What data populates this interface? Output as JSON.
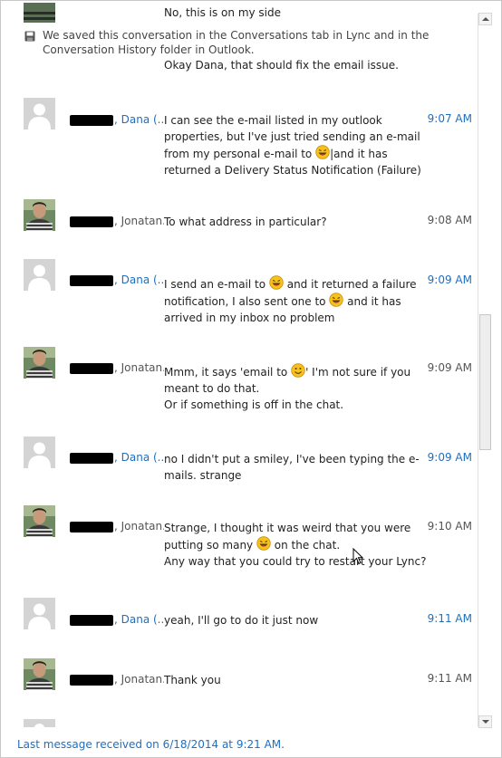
{
  "top_partial_text": "No, this is on my side",
  "saved_notice": "We saved this conversation in the Conversations tab in Lync and in the Conversation History folder in Outlook.",
  "saved_followup": "Okay Dana, that should fix the email issue.",
  "messages": [
    {
      "sender": "Dana (...",
      "is_me": true,
      "time": "9:07 AM",
      "parts": [
        "I can see the e-mail listed in my outlook properties, but I've just tried sending an e-mail from my personal e-mail to ",
        "[emoticon]",
        "|and it has returned a Delivery Status Notification (Failure)"
      ]
    },
    {
      "sender": "Jonatan...",
      "is_me": false,
      "time": "9:08 AM",
      "parts": [
        "To what address in particular?"
      ]
    },
    {
      "sender": "Dana (...",
      "is_me": true,
      "time": "9:09 AM",
      "parts": [
        "I send an e-mail to ",
        "[emoticon]",
        " and it returned a failure notification, I also sent one to ",
        "[emoticon]",
        " and it has arrived in my inbox no problem"
      ]
    },
    {
      "sender": "Jonatan...",
      "is_me": false,
      "time": "9:09 AM",
      "parts": [
        "Mmm, it says 'email to ",
        "[smile]",
        "' I'm not sure if you meant to do that.\nOr if something is off in the chat."
      ]
    },
    {
      "sender": "Dana (...",
      "is_me": true,
      "time": "9:09 AM",
      "parts": [
        "no I didn't put a smiley, I've been typing the e-mails. strange"
      ]
    },
    {
      "sender": "Jonatan...",
      "is_me": false,
      "time": "9:10 AM",
      "parts": [
        "Strange, I thought it was weird that you were putting so many ",
        "[emoticon]",
        " on the chat.\nAny way that you could try to restart your Lync?"
      ]
    },
    {
      "sender": "Dana (...",
      "is_me": true,
      "time": "9:11 AM",
      "parts": [
        "yeah, I'll go to do it just now"
      ]
    },
    {
      "sender": "Jonatan...",
      "is_me": false,
      "time": "9:11 AM",
      "parts": [
        "Thank you"
      ]
    }
  ],
  "status_bar": "Last message received on 6/18/2014 at 9:21 AM.",
  "colors": {
    "link_blue": "#1e6fc0",
    "text": "#222222",
    "muted": "#555555",
    "emoticon_yellow": "#f7c21a"
  },
  "icons": {
    "save": "floppy-disk-icon",
    "default_avatar": "default-person-avatar",
    "photo_avatar": "user-photo-avatar",
    "emoticon": "laughing-emoticon-icon",
    "smile": "smile-emoticon-icon"
  }
}
